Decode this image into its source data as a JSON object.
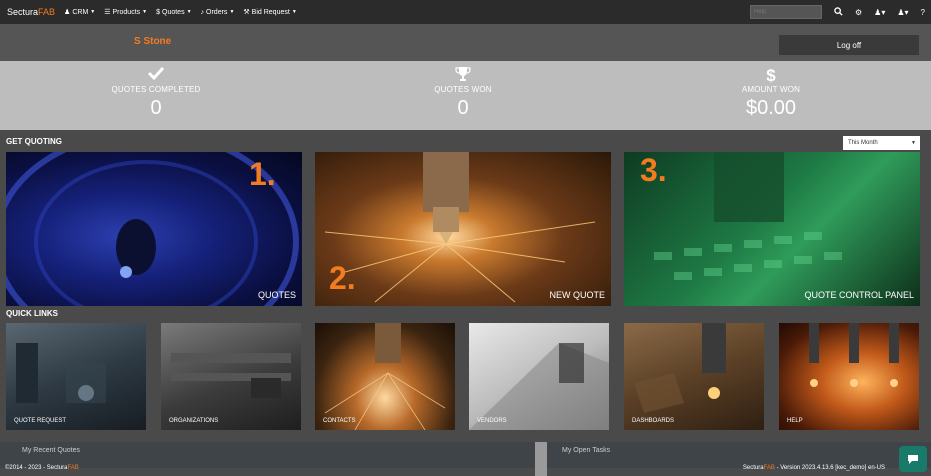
{
  "brand": {
    "name": "Sectura",
    "accent": "FAB"
  },
  "nav": [
    {
      "icon": "user-icon",
      "glyph": "♟",
      "label": "CRM"
    },
    {
      "icon": "list-icon",
      "glyph": "☰",
      "label": "Products"
    },
    {
      "icon": "dollar-icon",
      "glyph": "$",
      "label": "Quotes"
    },
    {
      "icon": "bell-icon",
      "glyph": "♪",
      "label": "Orders"
    },
    {
      "icon": "hammer-icon",
      "glyph": "⚒",
      "label": "Bid Request"
    }
  ],
  "search": {
    "placeholder": "Help"
  },
  "user": {
    "name": "S Stone",
    "logoff_label": "Log off"
  },
  "stats": [
    {
      "icon": "check-icon",
      "label": "QUOTES COMPLETED",
      "value": "0"
    },
    {
      "icon": "trophy-icon",
      "label": "QUOTES WON",
      "value": "0"
    },
    {
      "icon": "dollar-icon",
      "label": "AMOUNT WON",
      "value": "$0.00"
    }
  ],
  "get_quoting": {
    "title": "GET QUOTING",
    "period": "This Month",
    "tiles": [
      {
        "number": "1.",
        "caption": "QUOTES"
      },
      {
        "number": "2.",
        "caption": "NEW QUOTE"
      },
      {
        "number": "3.",
        "caption": "QUOTE CONTROL PANEL"
      }
    ]
  },
  "quick_links": {
    "title": "QUICK LINKS",
    "items": [
      "QUOTE REQUEST",
      "ORGANIZATIONS",
      "CONTACTS",
      "VENDORS",
      "DASHBOARDS",
      "HELP"
    ]
  },
  "panels": {
    "left": "My Recent Quotes",
    "right": "My Open Tasks"
  },
  "footer": {
    "left_prefix": "©2014 - 2023 - Sectura",
    "left_accent": "FAB",
    "right_prefix": "Sectura",
    "right_accent": "FAB",
    "right_suffix": " - Version 2023.4.13.6 [kec_demo] en-US"
  },
  "colors": {
    "accent": "#f47b20",
    "nav_bg": "#2b2b2b",
    "page_bg": "#4a4a4a",
    "stats_bg": "#bdbdbd"
  }
}
